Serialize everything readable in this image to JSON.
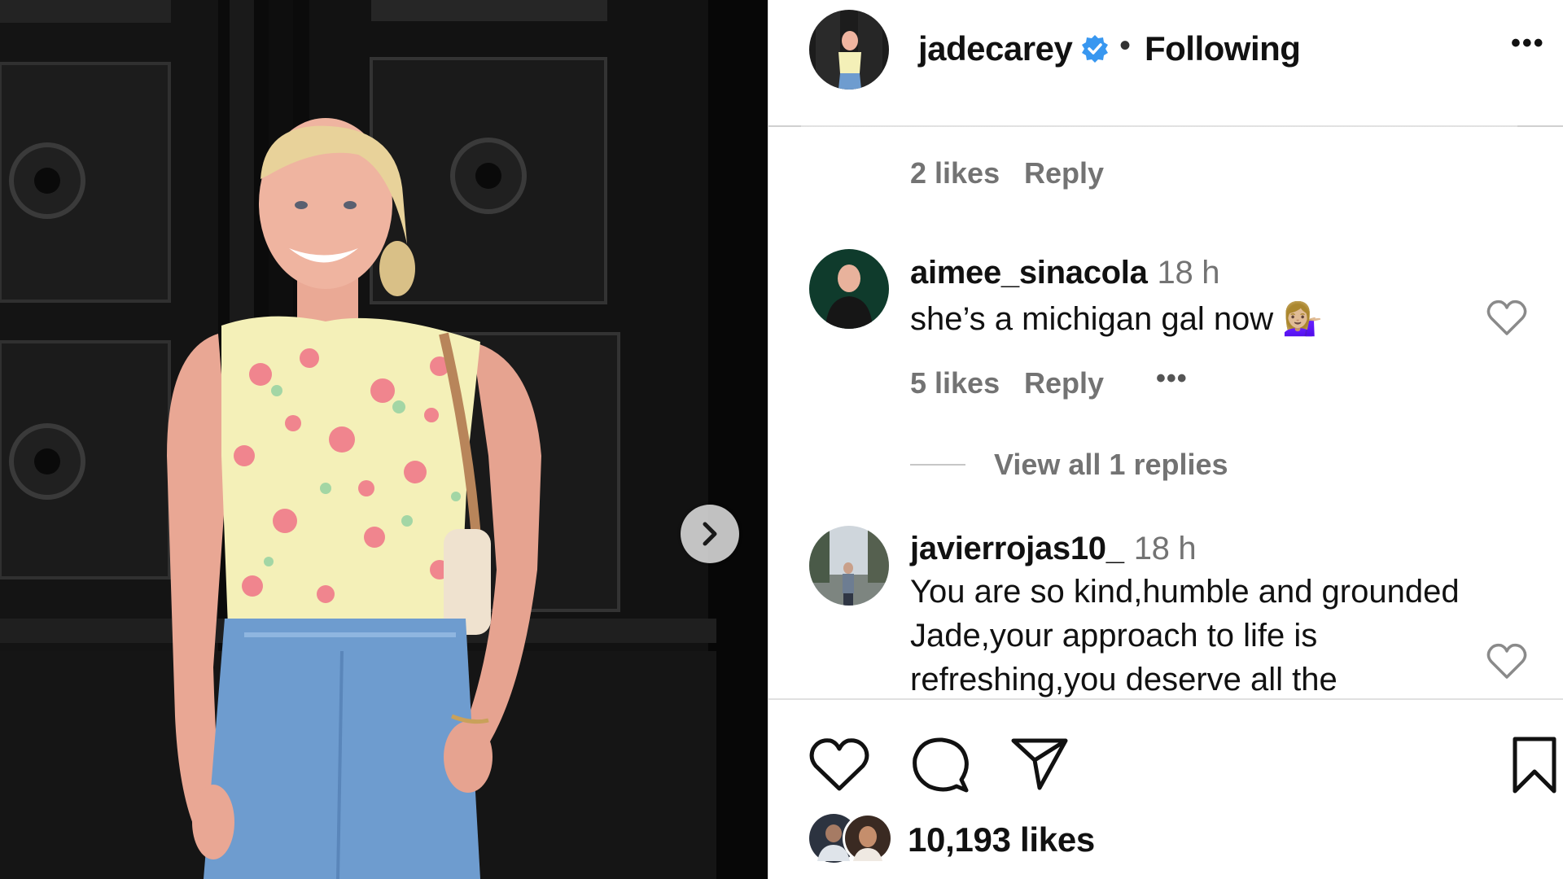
{
  "header": {
    "username": "jadecarey",
    "separator": "•",
    "following_label": "Following",
    "more_label": "•••"
  },
  "prev_comment": {
    "likes": "2 likes",
    "reply_label": "Reply"
  },
  "comments": [
    {
      "username": "aimee_sinacola",
      "time": "18 h",
      "text": "she’s a michigan gal now 💁🏼‍♀️",
      "likes": "5 likes",
      "reply_label": "Reply",
      "more_label": "•••",
      "view_replies": "View all 1 replies"
    },
    {
      "username": "javierrojas10_",
      "time": "18 h",
      "text": "You are so kind,humble and grounded Jade,your approach to life is refreshing,you deserve all the"
    }
  ],
  "post": {
    "likes_count": "10,193 likes"
  },
  "colors": {
    "verified": "#3897f0",
    "secondary_text": "#737373",
    "primary_text": "#111111"
  },
  "icons": {
    "like": "heart-icon",
    "comment": "comment-bubble-icon",
    "share": "paper-plane-icon",
    "save": "bookmark-icon",
    "next": "chevron-right-icon",
    "verified": "verified-badge-icon"
  }
}
